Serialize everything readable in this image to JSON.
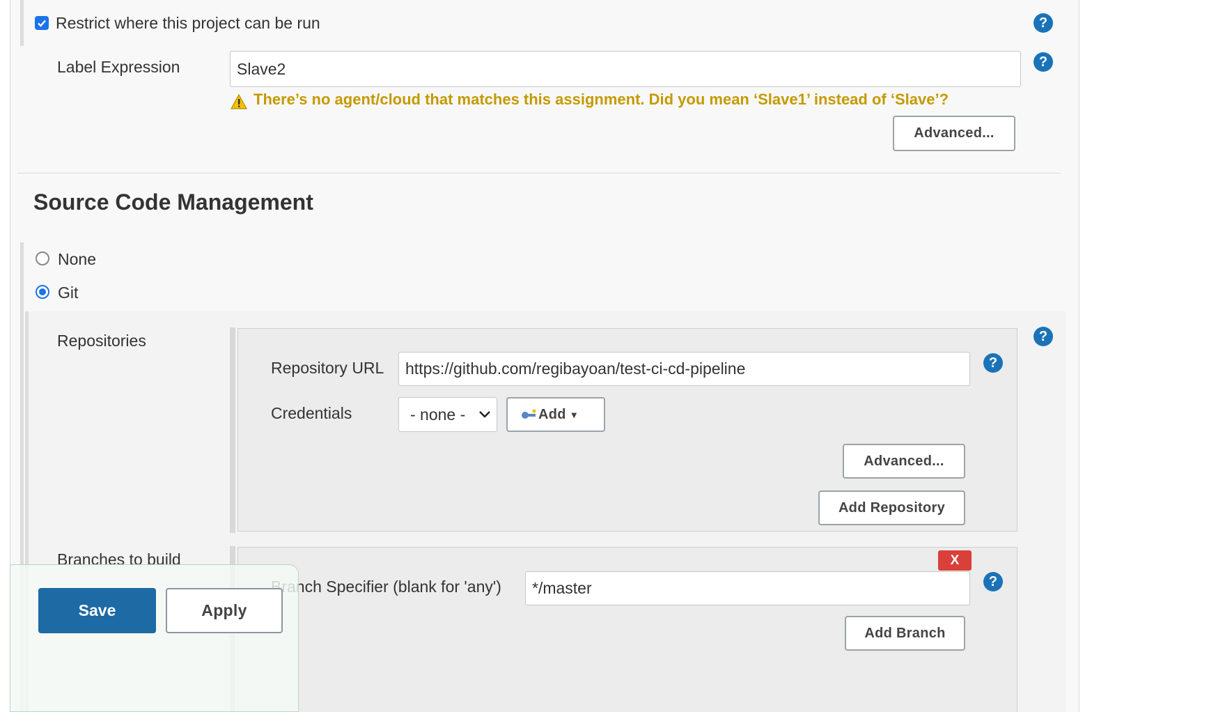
{
  "restrict": {
    "checkbox_label": "Restrict where this project can be run",
    "checked": true,
    "label_expression_label": "Label Expression",
    "label_expression_value": "Slave2",
    "warning_text": "There’s no agent/cloud that matches this assignment. Did you mean ‘Slave1’ instead of ‘Slave’?",
    "advanced_label": "Advanced..."
  },
  "scm": {
    "heading": "Source Code Management",
    "options": [
      {
        "label": "None",
        "selected": false
      },
      {
        "label": "Git",
        "selected": true
      }
    ],
    "repositories_label": "Repositories",
    "repo_url_label": "Repository URL",
    "repo_url_value": "https://github.com/regibayoan/test-ci-cd-pipeline",
    "credentials_label": "Credentials",
    "credentials_selected": "- none -",
    "add_label": "Add",
    "repo_advanced_label": "Advanced...",
    "add_repository_label": "Add Repository",
    "branches_label": "Branches to build",
    "delete_label": "X",
    "branch_specifier_label": "Branch Specifier (blank for 'any')",
    "branch_specifier_value": "*/master",
    "add_branch_label": "Add Branch"
  },
  "footer": {
    "save_label": "Save",
    "apply_label": "Apply"
  },
  "colors": {
    "accent": "#1a73b8",
    "warning": "#c49a00",
    "save_button": "#1d6aa5",
    "delete_button": "#d9403a"
  },
  "icons": {
    "help": "?",
    "warning": "⚠",
    "key": "key-icon",
    "caret": "▾",
    "check": "✓"
  }
}
